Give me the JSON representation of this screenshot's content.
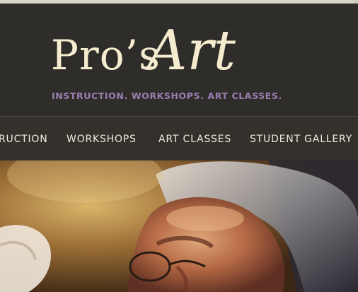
{
  "brand": {
    "pros": "Pro’s",
    "art": "Art",
    "tagline": "INSTRUCTION. WORKSHOPS. ART CLASSES."
  },
  "nav": {
    "items": [
      {
        "label": "RUCTION"
      },
      {
        "label": "WORKSHOPS"
      },
      {
        "label": "ART CLASSES"
      },
      {
        "label": "STUDENT GALLERY"
      }
    ]
  },
  "colors": {
    "header_bg": "#2f2d2a",
    "logo": "#f5ecd0",
    "tagline": "#9b7fb0",
    "nav_text": "#f1ead6"
  }
}
